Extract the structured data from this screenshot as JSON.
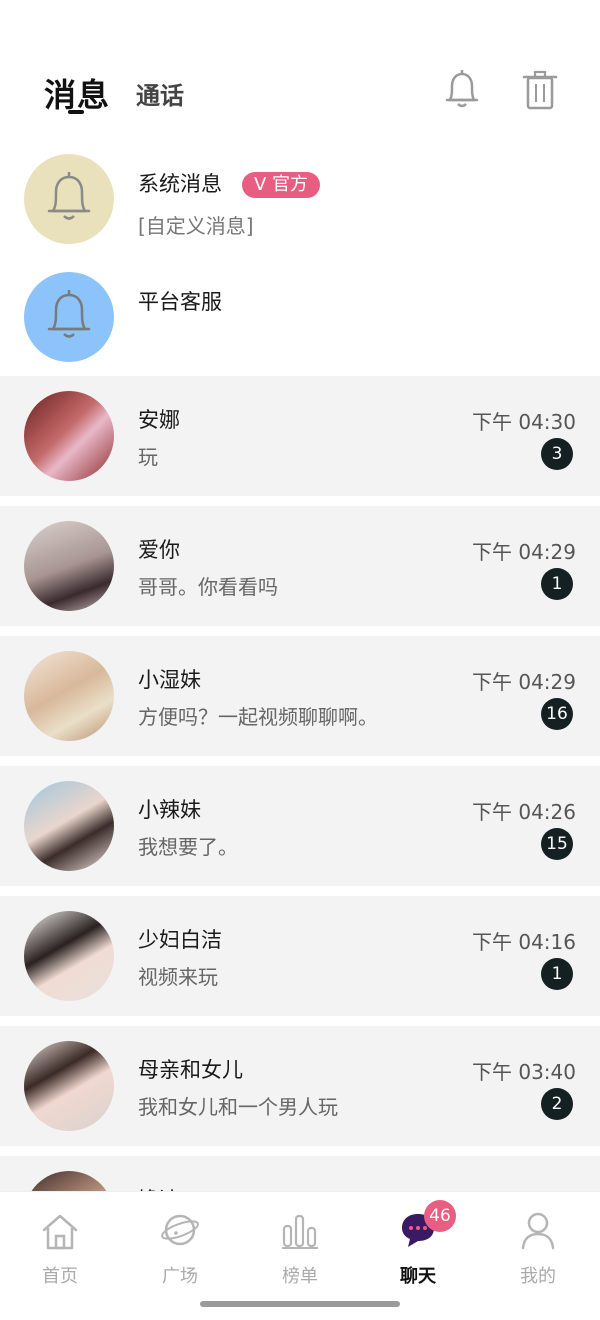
{
  "header": {
    "tabs": [
      {
        "label": "消息",
        "active": true
      },
      {
        "label": "通话",
        "active": false
      }
    ],
    "icons": [
      "bell-icon",
      "trash-icon"
    ]
  },
  "system": [
    {
      "name": "系统消息",
      "badge": "V 官方",
      "subtitle": "[自定义消息]",
      "avatar_color": "#e8e1bb",
      "icon": "bell-icon"
    },
    {
      "name": "平台客服",
      "avatar_color": "#8cc3fa",
      "icon": "bell-icon"
    }
  ],
  "chats": [
    {
      "name": "安娜",
      "message": "玩",
      "time": "下午 04:30",
      "unread": "3"
    },
    {
      "name": "爱你",
      "message": "哥哥。你看看吗",
      "time": "下午 04:29",
      "unread": "1"
    },
    {
      "name": "小湿妹",
      "message": "方便吗？一起视频聊聊啊。",
      "time": "下午 04:29",
      "unread": "16"
    },
    {
      "name": "小辣妹",
      "message": "我想要了。",
      "time": "下午 04:26",
      "unread": "15"
    },
    {
      "name": "少妇白洁",
      "message": "视频来玩",
      "time": "下午 04:16",
      "unread": "1"
    },
    {
      "name": "母亲和女儿",
      "message": "我和女儿和一个男人玩",
      "time": "下午 03:40",
      "unread": "2"
    },
    {
      "name": "馋达",
      "message": "",
      "time": "",
      "unread": ""
    }
  ],
  "nav": {
    "items": [
      {
        "label": "首页",
        "icon": "home-icon",
        "active": false
      },
      {
        "label": "广场",
        "icon": "planet-icon",
        "active": false
      },
      {
        "label": "榜单",
        "icon": "chart-icon",
        "active": false
      },
      {
        "label": "聊天",
        "icon": "chat-icon",
        "active": true
      },
      {
        "label": "我的",
        "icon": "profile-icon",
        "active": false
      }
    ],
    "chat_badge": "46"
  },
  "colors": {
    "official_badge": "#e85e82",
    "unread_badge": "#152022",
    "chat_row_bg": "#f3f3f4",
    "active_nav_icon": "#3a1a63"
  }
}
